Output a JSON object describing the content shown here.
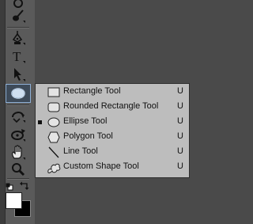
{
  "toolbar": {
    "tools": [
      {
        "name": "tool-partial-top",
        "icon": "circle-icon"
      },
      {
        "name": "tool-brush",
        "icon": "brush-icon"
      },
      {
        "name": "tool-pen",
        "icon": "pen-icon"
      },
      {
        "name": "tool-type",
        "icon": "type-icon",
        "glyph": "T"
      },
      {
        "name": "tool-path-selection",
        "icon": "arrow-icon"
      },
      {
        "name": "tool-ellipse",
        "icon": "ellipse-icon",
        "active": true
      },
      {
        "name": "tool-3d-rotate",
        "icon": "3d-rotate-icon"
      },
      {
        "name": "tool-3d-orbit",
        "icon": "3d-orbit-icon"
      },
      {
        "name": "tool-hand",
        "icon": "hand-icon"
      },
      {
        "name": "tool-zoom",
        "icon": "magnifier-icon"
      }
    ],
    "colors": {
      "foreground": "#ffffff",
      "background": "#000000",
      "active_border": "#8fb0d6"
    }
  },
  "shape_menu": {
    "items": [
      {
        "label": "Rectangle Tool",
        "shortcut": "U",
        "icon": "rectangle-icon",
        "selected": false
      },
      {
        "label": "Rounded Rectangle Tool",
        "shortcut": "U",
        "icon": "rounded-rectangle-icon",
        "selected": false
      },
      {
        "label": "Ellipse Tool",
        "shortcut": "U",
        "icon": "ellipse-icon",
        "selected": true
      },
      {
        "label": "Polygon Tool",
        "shortcut": "U",
        "icon": "polygon-icon",
        "selected": false
      },
      {
        "label": "Line Tool",
        "shortcut": "U",
        "icon": "line-icon",
        "selected": false
      },
      {
        "label": "Custom Shape Tool",
        "shortcut": "U",
        "icon": "custom-shape-icon",
        "selected": false
      }
    ]
  }
}
